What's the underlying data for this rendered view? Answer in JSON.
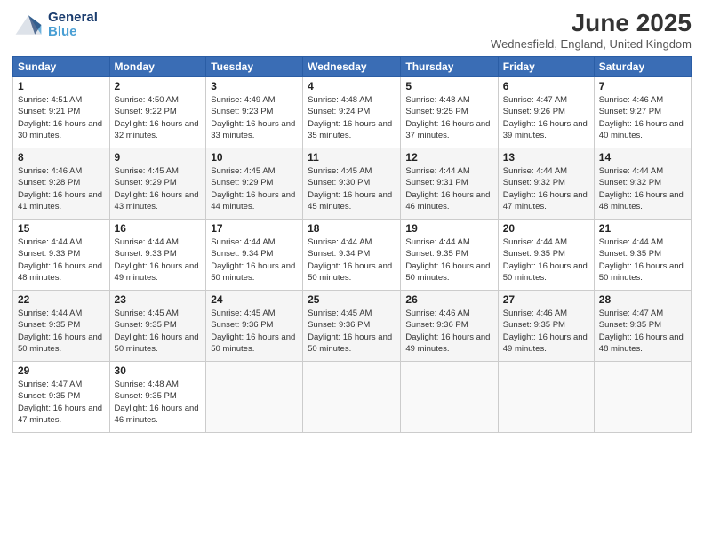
{
  "header": {
    "logo_general": "General",
    "logo_blue": "Blue",
    "title": "June 2025",
    "location": "Wednesfield, England, United Kingdom"
  },
  "days_of_week": [
    "Sunday",
    "Monday",
    "Tuesday",
    "Wednesday",
    "Thursday",
    "Friday",
    "Saturday"
  ],
  "weeks": [
    [
      {
        "day": "1",
        "sunrise": "Sunrise: 4:51 AM",
        "sunset": "Sunset: 9:21 PM",
        "daylight": "Daylight: 16 hours and 30 minutes."
      },
      {
        "day": "2",
        "sunrise": "Sunrise: 4:50 AM",
        "sunset": "Sunset: 9:22 PM",
        "daylight": "Daylight: 16 hours and 32 minutes."
      },
      {
        "day": "3",
        "sunrise": "Sunrise: 4:49 AM",
        "sunset": "Sunset: 9:23 PM",
        "daylight": "Daylight: 16 hours and 33 minutes."
      },
      {
        "day": "4",
        "sunrise": "Sunrise: 4:48 AM",
        "sunset": "Sunset: 9:24 PM",
        "daylight": "Daylight: 16 hours and 35 minutes."
      },
      {
        "day": "5",
        "sunrise": "Sunrise: 4:48 AM",
        "sunset": "Sunset: 9:25 PM",
        "daylight": "Daylight: 16 hours and 37 minutes."
      },
      {
        "day": "6",
        "sunrise": "Sunrise: 4:47 AM",
        "sunset": "Sunset: 9:26 PM",
        "daylight": "Daylight: 16 hours and 39 minutes."
      },
      {
        "day": "7",
        "sunrise": "Sunrise: 4:46 AM",
        "sunset": "Sunset: 9:27 PM",
        "daylight": "Daylight: 16 hours and 40 minutes."
      }
    ],
    [
      {
        "day": "8",
        "sunrise": "Sunrise: 4:46 AM",
        "sunset": "Sunset: 9:28 PM",
        "daylight": "Daylight: 16 hours and 41 minutes."
      },
      {
        "day": "9",
        "sunrise": "Sunrise: 4:45 AM",
        "sunset": "Sunset: 9:29 PM",
        "daylight": "Daylight: 16 hours and 43 minutes."
      },
      {
        "day": "10",
        "sunrise": "Sunrise: 4:45 AM",
        "sunset": "Sunset: 9:29 PM",
        "daylight": "Daylight: 16 hours and 44 minutes."
      },
      {
        "day": "11",
        "sunrise": "Sunrise: 4:45 AM",
        "sunset": "Sunset: 9:30 PM",
        "daylight": "Daylight: 16 hours and 45 minutes."
      },
      {
        "day": "12",
        "sunrise": "Sunrise: 4:44 AM",
        "sunset": "Sunset: 9:31 PM",
        "daylight": "Daylight: 16 hours and 46 minutes."
      },
      {
        "day": "13",
        "sunrise": "Sunrise: 4:44 AM",
        "sunset": "Sunset: 9:32 PM",
        "daylight": "Daylight: 16 hours and 47 minutes."
      },
      {
        "day": "14",
        "sunrise": "Sunrise: 4:44 AM",
        "sunset": "Sunset: 9:32 PM",
        "daylight": "Daylight: 16 hours and 48 minutes."
      }
    ],
    [
      {
        "day": "15",
        "sunrise": "Sunrise: 4:44 AM",
        "sunset": "Sunset: 9:33 PM",
        "daylight": "Daylight: 16 hours and 48 minutes."
      },
      {
        "day": "16",
        "sunrise": "Sunrise: 4:44 AM",
        "sunset": "Sunset: 9:33 PM",
        "daylight": "Daylight: 16 hours and 49 minutes."
      },
      {
        "day": "17",
        "sunrise": "Sunrise: 4:44 AM",
        "sunset": "Sunset: 9:34 PM",
        "daylight": "Daylight: 16 hours and 50 minutes."
      },
      {
        "day": "18",
        "sunrise": "Sunrise: 4:44 AM",
        "sunset": "Sunset: 9:34 PM",
        "daylight": "Daylight: 16 hours and 50 minutes."
      },
      {
        "day": "19",
        "sunrise": "Sunrise: 4:44 AM",
        "sunset": "Sunset: 9:35 PM",
        "daylight": "Daylight: 16 hours and 50 minutes."
      },
      {
        "day": "20",
        "sunrise": "Sunrise: 4:44 AM",
        "sunset": "Sunset: 9:35 PM",
        "daylight": "Daylight: 16 hours and 50 minutes."
      },
      {
        "day": "21",
        "sunrise": "Sunrise: 4:44 AM",
        "sunset": "Sunset: 9:35 PM",
        "daylight": "Daylight: 16 hours and 50 minutes."
      }
    ],
    [
      {
        "day": "22",
        "sunrise": "Sunrise: 4:44 AM",
        "sunset": "Sunset: 9:35 PM",
        "daylight": "Daylight: 16 hours and 50 minutes."
      },
      {
        "day": "23",
        "sunrise": "Sunrise: 4:45 AM",
        "sunset": "Sunset: 9:35 PM",
        "daylight": "Daylight: 16 hours and 50 minutes."
      },
      {
        "day": "24",
        "sunrise": "Sunrise: 4:45 AM",
        "sunset": "Sunset: 9:36 PM",
        "daylight": "Daylight: 16 hours and 50 minutes."
      },
      {
        "day": "25",
        "sunrise": "Sunrise: 4:45 AM",
        "sunset": "Sunset: 9:36 PM",
        "daylight": "Daylight: 16 hours and 50 minutes."
      },
      {
        "day": "26",
        "sunrise": "Sunrise: 4:46 AM",
        "sunset": "Sunset: 9:36 PM",
        "daylight": "Daylight: 16 hours and 49 minutes."
      },
      {
        "day": "27",
        "sunrise": "Sunrise: 4:46 AM",
        "sunset": "Sunset: 9:35 PM",
        "daylight": "Daylight: 16 hours and 49 minutes."
      },
      {
        "day": "28",
        "sunrise": "Sunrise: 4:47 AM",
        "sunset": "Sunset: 9:35 PM",
        "daylight": "Daylight: 16 hours and 48 minutes."
      }
    ],
    [
      {
        "day": "29",
        "sunrise": "Sunrise: 4:47 AM",
        "sunset": "Sunset: 9:35 PM",
        "daylight": "Daylight: 16 hours and 47 minutes."
      },
      {
        "day": "30",
        "sunrise": "Sunrise: 4:48 AM",
        "sunset": "Sunset: 9:35 PM",
        "daylight": "Daylight: 16 hours and 46 minutes."
      },
      null,
      null,
      null,
      null,
      null
    ]
  ]
}
